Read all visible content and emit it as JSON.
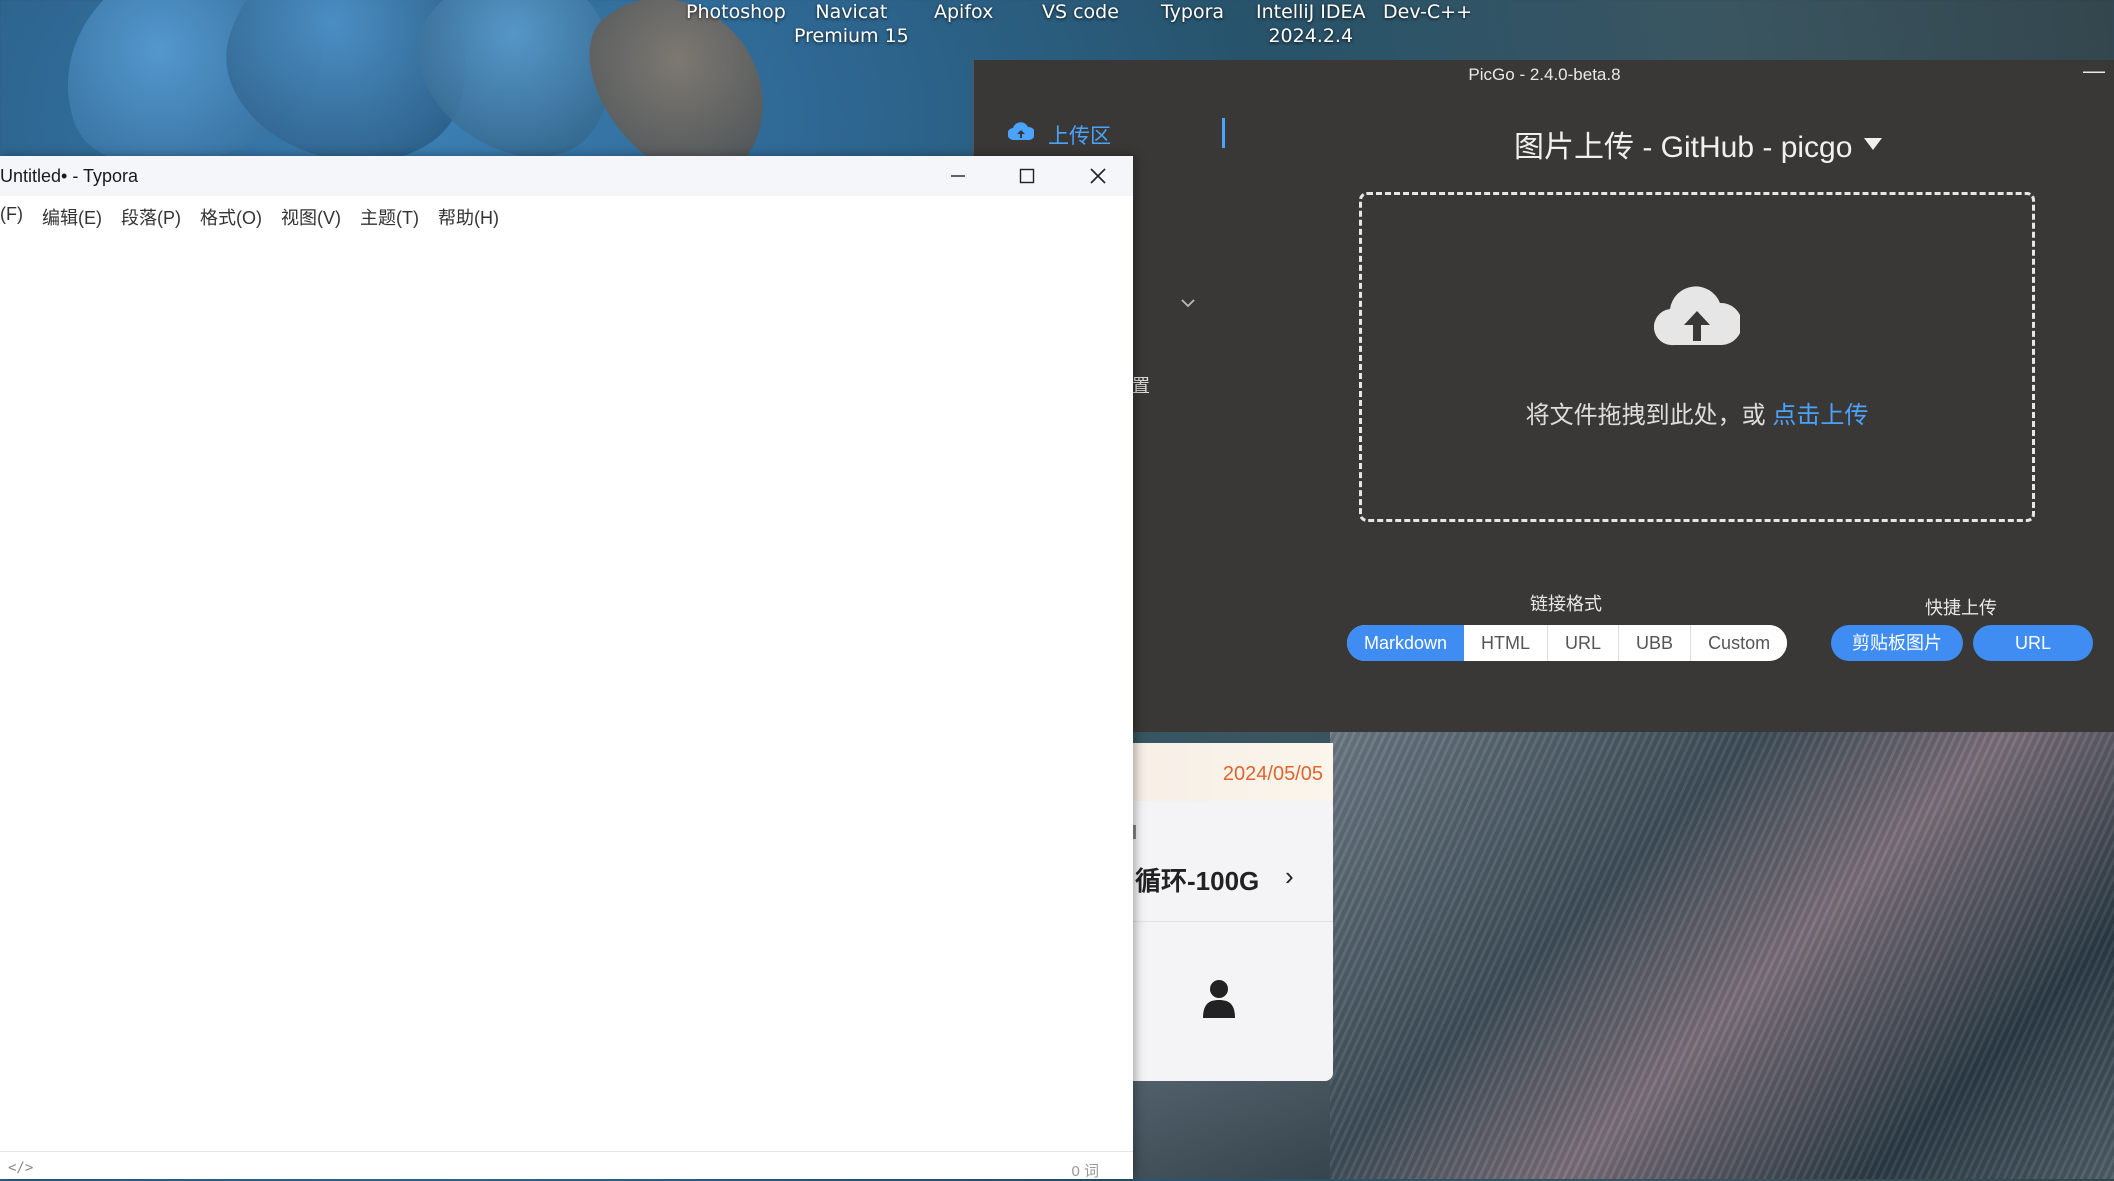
{
  "desktop": {
    "icons": [
      {
        "label": "Photoshop"
      },
      {
        "label": "Navicat\nPremium 15"
      },
      {
        "label": "Apifox"
      },
      {
        "label": "VS code"
      },
      {
        "label": "Typora"
      },
      {
        "label": "IntelliJ IDEA\n2024.2.4"
      },
      {
        "label": "Dev-C++"
      }
    ]
  },
  "picgo": {
    "title": "PicGo - 2.4.0-beta.8",
    "minimize": "—",
    "sidebar": {
      "active_label": "上传区"
    },
    "header": "图片上传 - GitHub - picgo",
    "dropzone": {
      "text": "将文件拖拽到此处，或 ",
      "link": "点击上传"
    },
    "link_format": {
      "title": "链接格式",
      "options": [
        "Markdown",
        "HTML",
        "URL",
        "UBB",
        "Custom"
      ],
      "selected": "Markdown"
    },
    "quick_upload": {
      "title": "快捷上传",
      "clipboard_label": "剪贴板图片",
      "url_label": "URL"
    },
    "accent": "#3f8cf2"
  },
  "background_app": {
    "date": "2024/05/05",
    "plan": "循环-100G",
    "arrow": "›",
    "stray_char": "置"
  },
  "typora": {
    "title": "Untitled• - Typora",
    "menu": [
      "(F)",
      "编辑(E)",
      "段落(P)",
      "格式(O)",
      "视图(V)",
      "主题(T)",
      "帮助(H)"
    ],
    "status": {
      "source_toggle": "</>",
      "word_count": "0 词"
    }
  }
}
